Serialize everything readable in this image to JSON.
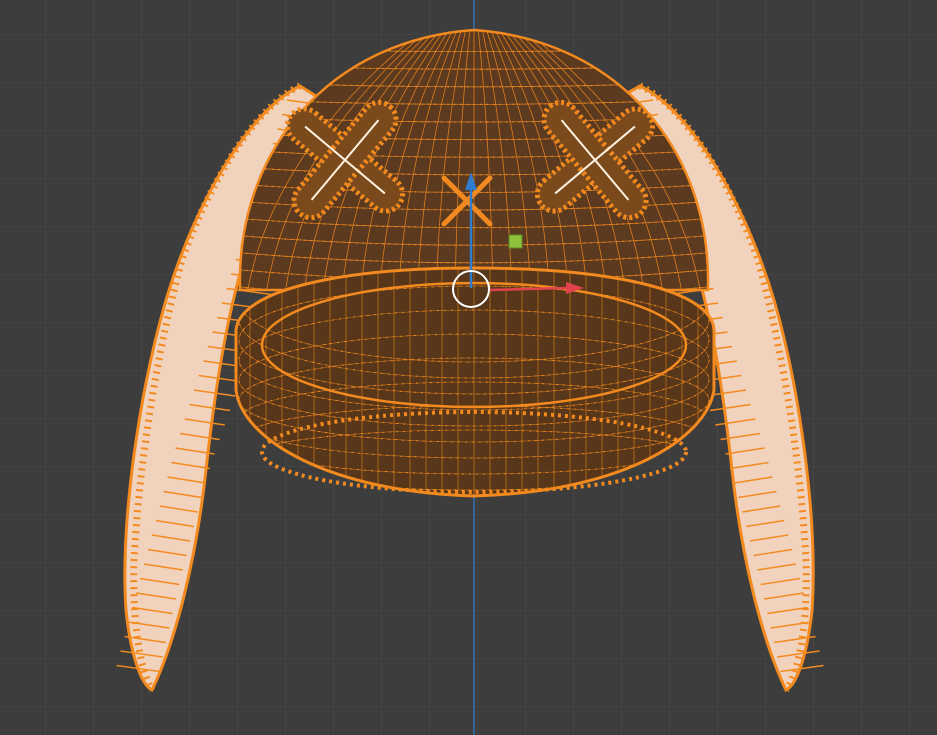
{
  "viewport": {
    "mode": "edit-mode",
    "background_color": "#3d3d3d",
    "grid_color": "#4a4a4a",
    "z_axis_color": "#2f7dd0",
    "x_axis_color": "#e0424e",
    "y_axis_color": "#8fc13c"
  },
  "mesh": {
    "object": "rabbit-hat",
    "parts": [
      "cap",
      "brim",
      "left-ear",
      "right-ear",
      "left-x-patch",
      "right-x-patch"
    ],
    "wire_color": "#f28a1f",
    "vertex_color": "#ff8c1a",
    "face_fill_color": "#5c3a1f",
    "ear_inner_color": "#f1d2bd",
    "selected_edge_color": "#fff2e2"
  },
  "gizmo": {
    "icons": [
      "origin-cross-icon",
      "pivot-circle-icon",
      "move-arrow-z-icon",
      "move-arrow-x-icon",
      "move-handle-y-icon"
    ]
  }
}
